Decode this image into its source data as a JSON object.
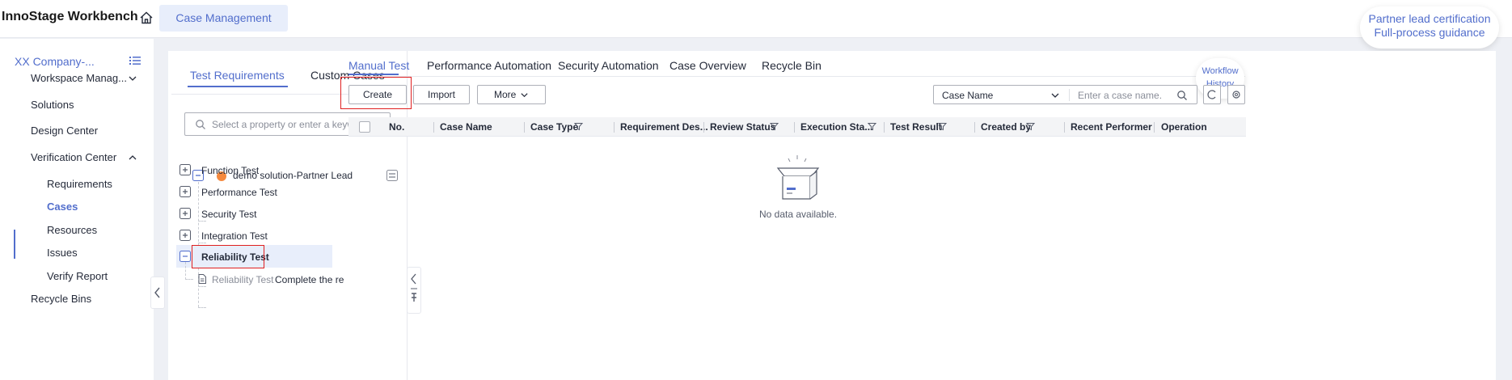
{
  "header": {
    "app_title": "InnoStage Workbench",
    "active_tab": "Case Management",
    "partner_line1": "Partner lead certification",
    "partner_line2": "Full-process guidance"
  },
  "sidebar": {
    "company": "XX Company-...",
    "items": [
      {
        "label": "Workspace Manag...",
        "expanded": false
      },
      {
        "label": "Solutions"
      },
      {
        "label": "Design Center"
      },
      {
        "label": "Verification Center",
        "expanded": true
      },
      {
        "label": "Recycle Bins"
      }
    ],
    "sub_items": [
      {
        "label": "Requirements"
      },
      {
        "label": "Cases",
        "active": true
      },
      {
        "label": "Resources"
      },
      {
        "label": "Issues"
      },
      {
        "label": "Verify Report"
      }
    ]
  },
  "tree_panel": {
    "tabs": [
      "Test Requirements",
      "Custom Cases"
    ],
    "active_tab": "Test Requirements",
    "search_placeholder": "Select a property or enter a keyword",
    "root": "demo solution-Partner Lead",
    "nodes": [
      "Function Test",
      "Performance Test",
      "Security Test",
      "Integration Test",
      "Reliability Test"
    ],
    "selected_node": "Reliability Test",
    "leaf_name": "Reliability Test",
    "leaf_desc": "Complete the re"
  },
  "content": {
    "tabs": [
      "Manual Test",
      "Performance Automation",
      "Security Automation",
      "Case Overview",
      "Recycle Bin"
    ],
    "active_tab": "Manual Test",
    "buttons": {
      "create": "Create",
      "import": "Import",
      "more": "More"
    },
    "search": {
      "field": "Case Name",
      "placeholder": "Enter a case name."
    },
    "workflow_line1": "Workflow",
    "workflow_line2": "History",
    "columns": [
      "No.",
      "Case Name",
      "Case Type",
      "Requirement Des...",
      "Review Status",
      "Execution Sta...",
      "Test Result",
      "Created by",
      "Recent Performer",
      "Operation"
    ],
    "empty_text": "No data available."
  },
  "colors": {
    "accent": "#526ecc",
    "highlight": "#e02020",
    "dot": "#f5893d"
  }
}
